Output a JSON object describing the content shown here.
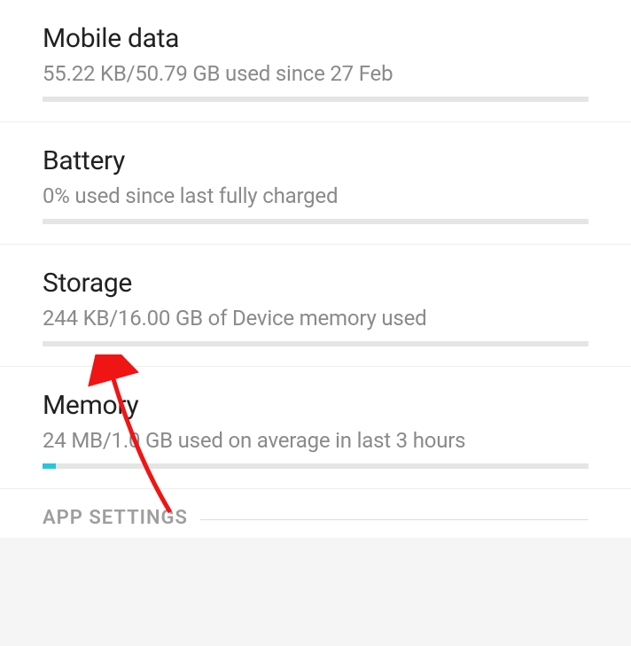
{
  "items": {
    "mobileData": {
      "title": "Mobile data",
      "subtitle": "55.22 KB/50.79 GB used since 27 Feb",
      "progressPct": 0
    },
    "battery": {
      "title": "Battery",
      "subtitle": "0% used since last fully charged",
      "progressPct": 0
    },
    "storage": {
      "title": "Storage",
      "subtitle": "244 KB/16.00 GB of Device memory used",
      "progressPct": 0
    },
    "memory": {
      "title": "Memory",
      "subtitle": "24 MB/1.0 GB used on average in last 3 hours",
      "progressPct": 2.4
    }
  },
  "section": {
    "appSettings": "APP SETTINGS"
  },
  "annotation": {
    "arrowColor": "#ef1515"
  }
}
